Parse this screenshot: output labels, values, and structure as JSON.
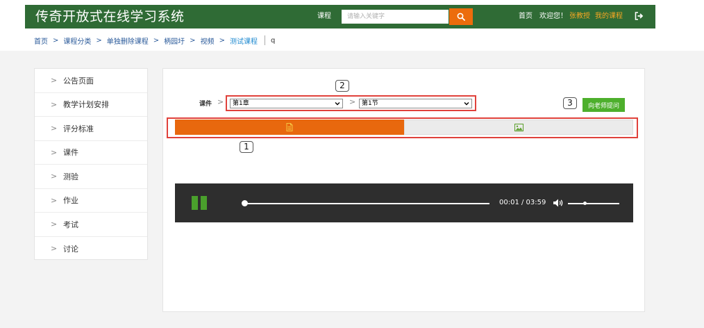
{
  "header": {
    "site_title": "传奇开放式在线学习系统",
    "search_label": "课程",
    "search_placeholder": "请输入关键字",
    "search_icon": "search-icon",
    "nav_home": "首页",
    "welcome": "欢迎您！",
    "user_name": "张教授",
    "my_courses": "我的课程",
    "logout_icon": "logout-icon",
    "bg_color": "#2f6b35",
    "accent_color": "#ec6c0c"
  },
  "breadcrumb": {
    "items": [
      "首页",
      "课程分类",
      "单独删除课程",
      "柄园圩",
      "视频",
      "测试课程"
    ],
    "trailing": "q"
  },
  "sidebar": {
    "items": [
      {
        "label": "公告页面"
      },
      {
        "label": "教学计划安排"
      },
      {
        "label": "评分标准"
      },
      {
        "label": "课件"
      },
      {
        "label": "测验"
      },
      {
        "label": "作业"
      },
      {
        "label": "考试"
      },
      {
        "label": "讨论"
      }
    ]
  },
  "courseware": {
    "label": "课件",
    "chapter_value": "第1章",
    "section_value": "第1节",
    "ask_teacher_label": "向老师提问",
    "ask_color": "#4daf2c"
  },
  "callouts": {
    "one": "1",
    "two": "2",
    "three": "3"
  },
  "tabs": {
    "active_icon": "document-icon",
    "inactive_icon": "image-icon",
    "active_color": "#e8680e"
  },
  "player": {
    "state": "playing",
    "current_time": "00:01",
    "duration": "03:59",
    "time_display": "00:01 / 03:59",
    "progress_fraction": 0.004,
    "volume_fraction": 0.32
  }
}
